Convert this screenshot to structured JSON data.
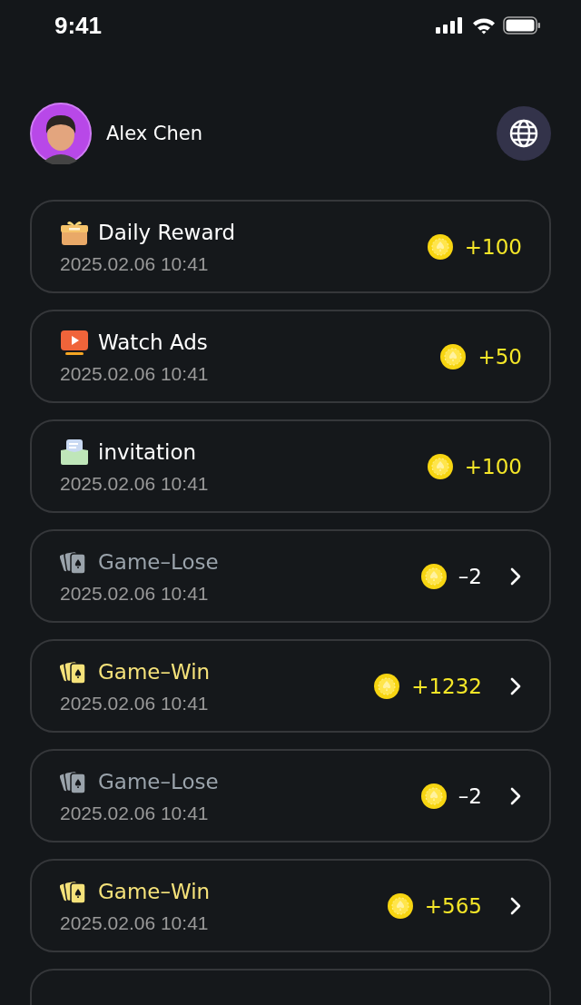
{
  "status_bar": {
    "time": "9:41"
  },
  "profile": {
    "name": "Alex Chen"
  },
  "records": [
    {
      "kind": "reward",
      "title": "Daily Reward",
      "time": "2025.02.06 10:41",
      "amount": "+100",
      "has_details": false
    },
    {
      "kind": "ads",
      "title": "Watch Ads",
      "time": "2025.02.06 10:41",
      "amount": "+50",
      "has_details": false
    },
    {
      "kind": "invitation",
      "title": "invitation",
      "time": "2025.02.06 10:41",
      "amount": "+100",
      "has_details": false
    },
    {
      "kind": "lose",
      "title": "Game–Lose",
      "time": "2025.02.06 10:41",
      "amount": "–2",
      "has_details": true
    },
    {
      "kind": "win",
      "title": "Game–Win",
      "time": "2025.02.06 10:41",
      "amount": "+1232",
      "has_details": true
    },
    {
      "kind": "lose",
      "title": "Game–Lose",
      "time": "2025.02.06 10:41",
      "amount": "–2",
      "has_details": true
    },
    {
      "kind": "win",
      "title": "Game–Win",
      "time": "2025.02.06 10:41",
      "amount": "+565",
      "has_details": true
    }
  ]
}
